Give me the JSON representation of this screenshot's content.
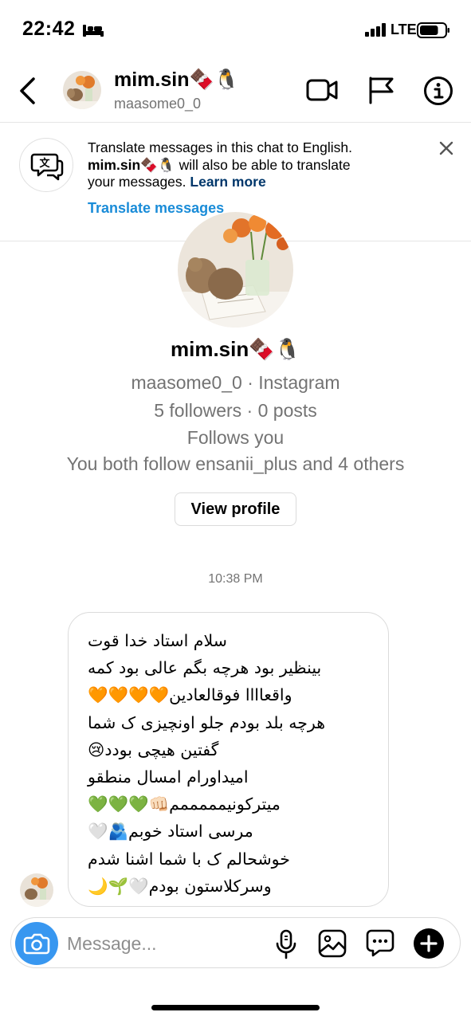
{
  "status_bar": {
    "time": "22:42",
    "network": "LTE",
    "battery_level": 0.75
  },
  "header": {
    "display_name": "mim.sin🍫🐧",
    "username": "maasome0_0",
    "icons": [
      "back-arrow",
      "video-camera",
      "flag",
      "info"
    ]
  },
  "translate_banner": {
    "line1": "Translate messages in this chat to English.",
    "name": "mim.sin🍫🐧",
    "line2": " will also be able to translate",
    "line3": "your messages. ",
    "learn_more": "Learn more",
    "action": "Translate messages"
  },
  "profile": {
    "display_name": "mim.sin🍫🐧",
    "username_line": "maasome0_0 · Instagram",
    "stats": "5 followers · 0 posts",
    "follows": "Follows you",
    "mutual": "You both follow ensanii_plus and 4 others",
    "button": "View profile"
  },
  "chat": {
    "timestamp": "10:38 PM",
    "message_lines": [
      "سلام استاد خدا قوت",
      "بینظیر بود هرچه بگم عالی بود کمه",
      "واقعاااا فوقالعادین🧡🧡🧡🧡",
      "هرچه بلد بودم جلو اونچیزی ک شما",
      "گفتین هیچی بودد😢",
      "امیداورام امسال منطقو",
      "میترکونیمممممم👊🏻💚💚💚",
      "مرسی استاد خوبم🫂🤍",
      "خوشحالم ک با شما اشنا شدم",
      "وسرکلاستون بودم🤍🌱🌙"
    ]
  },
  "composer": {
    "placeholder": "Message..."
  },
  "colors": {
    "accent_blue": "#1a8cd8",
    "camera_blue": "#3897f0",
    "secondary_text": "#737373",
    "border": "#dbdbdb"
  }
}
